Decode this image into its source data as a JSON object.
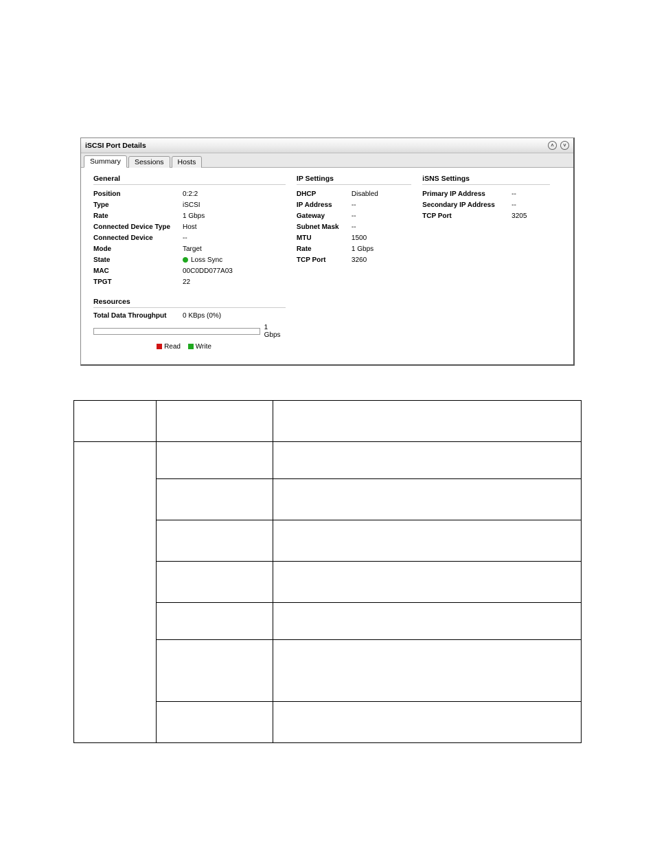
{
  "panel": {
    "title": "iSCSI Port Details",
    "tabs": [
      "Summary",
      "Sessions",
      "Hosts"
    ],
    "sections": {
      "general": {
        "heading": "General",
        "rows": [
          {
            "label": "Position",
            "value": "0:2:2"
          },
          {
            "label": "Type",
            "value": "iSCSI"
          },
          {
            "label": "Rate",
            "value": "1 Gbps"
          },
          {
            "label": "Connected Device Type",
            "value": "Host"
          },
          {
            "label": "Connected Device",
            "value": "--"
          },
          {
            "label": "Mode",
            "value": "Target"
          },
          {
            "label": "State",
            "value": "Loss Sync",
            "dot": true
          },
          {
            "label": "MAC",
            "value": "00C0DD077A03"
          },
          {
            "label": "TPGT",
            "value": "22"
          }
        ]
      },
      "ip": {
        "heading": "IP Settings",
        "rows": [
          {
            "label": "DHCP",
            "value": "Disabled"
          },
          {
            "label": "IP Address",
            "value": "--"
          },
          {
            "label": "Gateway",
            "value": "--"
          },
          {
            "label": "Subnet Mask",
            "value": "--"
          },
          {
            "label": "MTU",
            "value": "1500"
          },
          {
            "label": "Rate",
            "value": "1 Gbps"
          },
          {
            "label": "TCP Port",
            "value": "3260"
          }
        ]
      },
      "isns": {
        "heading": "iSNS Settings",
        "rows": [
          {
            "label": "Primary IP Address",
            "value": "--"
          },
          {
            "label": "Secondary IP Address",
            "value": "--"
          },
          {
            "label": "TCP Port",
            "value": "3205"
          }
        ]
      }
    },
    "resources": {
      "heading": "Resources",
      "throughput_label": "Total Data Throughput",
      "throughput_value": "0 KBps (0%)",
      "bar_max": "1 Gbps",
      "legend_read": "Read",
      "legend_write": "Write"
    }
  }
}
